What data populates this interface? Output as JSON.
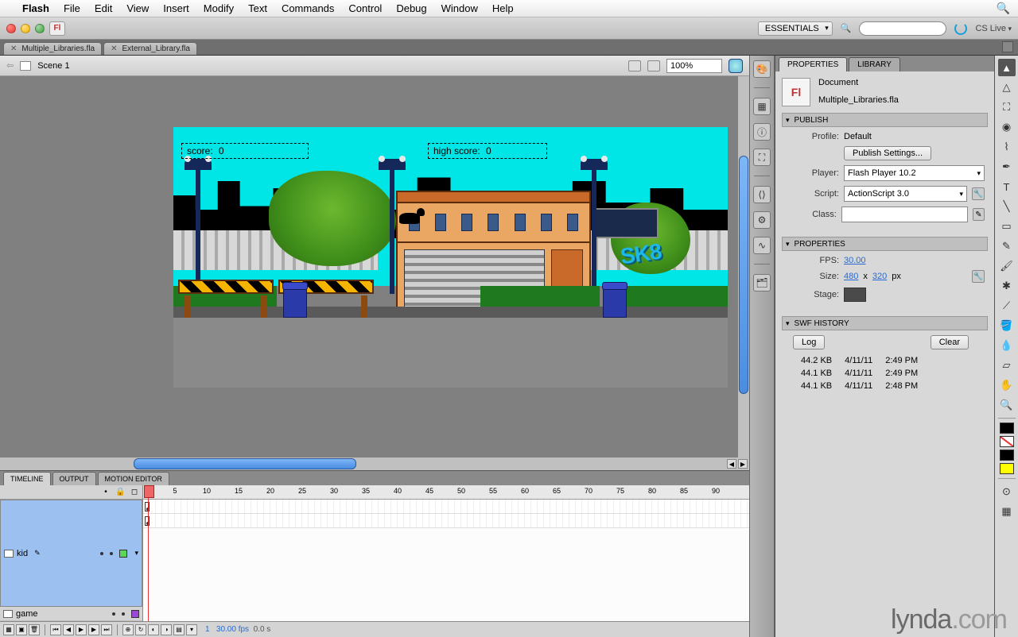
{
  "menubar": {
    "items": [
      "Flash",
      "File",
      "Edit",
      "View",
      "Insert",
      "Modify",
      "Text",
      "Commands",
      "Control",
      "Debug",
      "Window",
      "Help"
    ]
  },
  "titlebar": {
    "workspace": "ESSENTIALS",
    "search_placeholder": "",
    "cslive": "CS Live"
  },
  "file_tabs": [
    {
      "label": "Multiple_Libraries.fla"
    },
    {
      "label": "External_Library.fla"
    }
  ],
  "stage_bar": {
    "scene": "Scene 1",
    "zoom": "100%"
  },
  "stage": {
    "score_label": "score:",
    "score_value": "0",
    "highscore_label": "high score:",
    "highscore_value": "0",
    "graffiti": "SK8"
  },
  "timeline": {
    "tabs": [
      "TIMELINE",
      "OUTPUT",
      "MOTION EDITOR"
    ],
    "ruler": [
      "1",
      "5",
      "10",
      "15",
      "20",
      "25",
      "30",
      "35",
      "40",
      "45",
      "50",
      "55",
      "60",
      "65",
      "70",
      "75",
      "80",
      "85",
      "90"
    ],
    "layers": [
      {
        "name": "kid",
        "selected": true,
        "color": "#5bd65b"
      },
      {
        "name": "game",
        "selected": false,
        "color": "#9a4ad6"
      }
    ],
    "footer": {
      "frame": "1",
      "fps": "30.00 fps",
      "time": "0.0 s"
    }
  },
  "vdock": [
    "palette",
    "window",
    "info",
    "guides",
    "align",
    "transform",
    "link",
    "library"
  ],
  "props": {
    "tabs": [
      "PROPERTIES",
      "LIBRARY"
    ],
    "doc_type": "Document",
    "doc_name": "Multiple_Libraries.fla",
    "publish": {
      "title": "PUBLISH",
      "profile_label": "Profile:",
      "profile_value": "Default",
      "settings_btn": "Publish Settings...",
      "player_label": "Player:",
      "player_value": "Flash Player 10.2",
      "script_label": "Script:",
      "script_value": "ActionScript 3.0",
      "class_label": "Class:",
      "class_value": ""
    },
    "properties": {
      "title": "PROPERTIES",
      "fps_label": "FPS:",
      "fps_value": "30.00",
      "size_label": "Size:",
      "width": "480",
      "x": "x",
      "height": "320",
      "px": "px",
      "stage_label": "Stage:"
    },
    "history": {
      "title": "SWF HISTORY",
      "log_btn": "Log",
      "clear_btn": "Clear",
      "rows": [
        {
          "size": "44.2 KB",
          "date": "4/11/11",
          "time": "2:49 PM"
        },
        {
          "size": "44.1 KB",
          "date": "4/11/11",
          "time": "2:49 PM"
        },
        {
          "size": "44.1 KB",
          "date": "4/11/11",
          "time": "2:48 PM"
        }
      ]
    }
  },
  "toolbox": [
    "selection",
    "subselection",
    "free-transform",
    "3d-rotation",
    "lasso",
    "pen",
    "text",
    "line",
    "rectangle",
    "pencil",
    "brush",
    "deco",
    "bone",
    "paint-bucket",
    "eyedropper",
    "eraser",
    "hand",
    "zoom"
  ],
  "watermark": {
    "a": "lynda",
    "b": ".com"
  }
}
